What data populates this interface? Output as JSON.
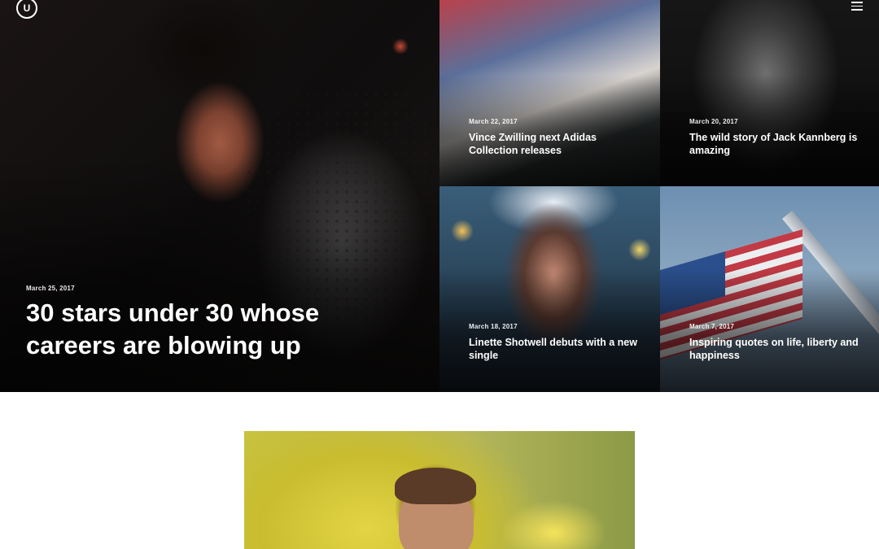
{
  "header": {
    "logo_letter": "U",
    "menu_icon": "hamburger-icon"
  },
  "featured": {
    "main": {
      "date": "March 25, 2017",
      "title": "30 stars under 30 whose careers are blowing up"
    },
    "tiles": [
      {
        "date": "March 22, 2017",
        "title": "Vince Zwilling next Adidas Collection releases"
      },
      {
        "date": "March 20, 2017",
        "title": "The wild story of Jack Kannberg is amazing"
      },
      {
        "date": "March 18, 2017",
        "title": "Linette Shotwell debuts with a new single"
      },
      {
        "date": "March 7, 2017",
        "title": "Inspiring quotes on life, liberty and happiness"
      }
    ]
  },
  "colors": {
    "hero_bg": "#0c0c0e",
    "page_bg": "#ffffff",
    "text_light": "#ffffff"
  }
}
